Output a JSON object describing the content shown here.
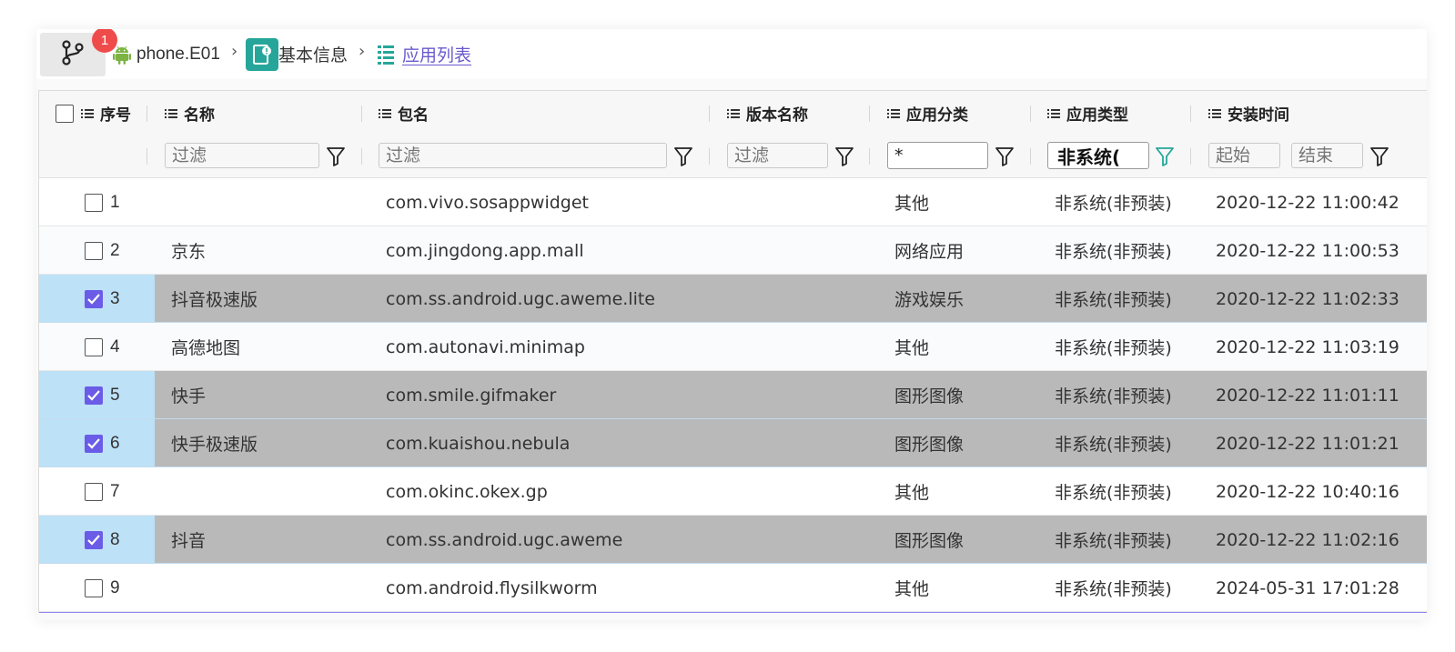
{
  "breadcrumb": {
    "badge_count": "1",
    "device": "phone.E01",
    "info": "基本信息",
    "list": "应用列表"
  },
  "table": {
    "headers": [
      "序号",
      "名称",
      "包名",
      "版本名称",
      "应用分类",
      "应用类型",
      "安装时间"
    ],
    "filters": {
      "name_placeholder": "过滤",
      "package_placeholder": "过滤",
      "version_placeholder": "过滤",
      "category_value": "*",
      "type_value": "非系统(",
      "time_start_placeholder": "起始",
      "time_end_placeholder": "结束"
    },
    "rows": [
      {
        "no": "1",
        "name": "",
        "package": "com.vivo.sosappwidget",
        "version": "",
        "category": "其他",
        "type": "非系统(非预装)",
        "time": "2020-12-22 11:00:42",
        "selected": false
      },
      {
        "no": "2",
        "name": "京东",
        "package": "com.jingdong.app.mall",
        "version": "",
        "category": "网络应用",
        "type": "非系统(非预装)",
        "time": "2020-12-22 11:00:53",
        "selected": false
      },
      {
        "no": "3",
        "name": "抖音极速版",
        "package": "com.ss.android.ugc.aweme.lite",
        "version": "",
        "category": "游戏娱乐",
        "type": "非系统(非预装)",
        "time": "2020-12-22 11:02:33",
        "selected": true
      },
      {
        "no": "4",
        "name": "高德地图",
        "package": "com.autonavi.minimap",
        "version": "",
        "category": "其他",
        "type": "非系统(非预装)",
        "time": "2020-12-22 11:03:19",
        "selected": false
      },
      {
        "no": "5",
        "name": "快手",
        "package": "com.smile.gifmaker",
        "version": "",
        "category": "图形图像",
        "type": "非系统(非预装)",
        "time": "2020-12-22 11:01:11",
        "selected": true
      },
      {
        "no": "6",
        "name": "快手极速版",
        "package": "com.kuaishou.nebula",
        "version": "",
        "category": "图形图像",
        "type": "非系统(非预装)",
        "time": "2020-12-22 11:01:21",
        "selected": true
      },
      {
        "no": "7",
        "name": "",
        "package": "com.okinc.okex.gp",
        "version": "",
        "category": "其他",
        "type": "非系统(非预装)",
        "time": "2020-12-22 10:40:16",
        "selected": false
      },
      {
        "no": "8",
        "name": "抖音",
        "package": "com.ss.android.ugc.aweme",
        "version": "",
        "category": "图形图像",
        "type": "非系统(非预装)",
        "time": "2020-12-22 11:02:16",
        "selected": true
      },
      {
        "no": "9",
        "name": "",
        "package": "com.android.flysilkworm",
        "version": "",
        "category": "其他",
        "type": "非系统(非预装)",
        "time": "2024-05-31 17:01:28",
        "selected": false
      }
    ]
  },
  "colors": {
    "badge": "#f04b4b",
    "android": "#7cb342",
    "info_icon": "#26a69a",
    "checkbox_checked": "#6b5ce7",
    "selected_row": "#b9b9b9",
    "selected_cell": "#bde1f7",
    "active_filter": "#26a69a"
  },
  "icons": [
    "git-branch-icon",
    "android-icon",
    "info-card-icon",
    "list-icon",
    "column-menu-icon",
    "filter-icon"
  ]
}
